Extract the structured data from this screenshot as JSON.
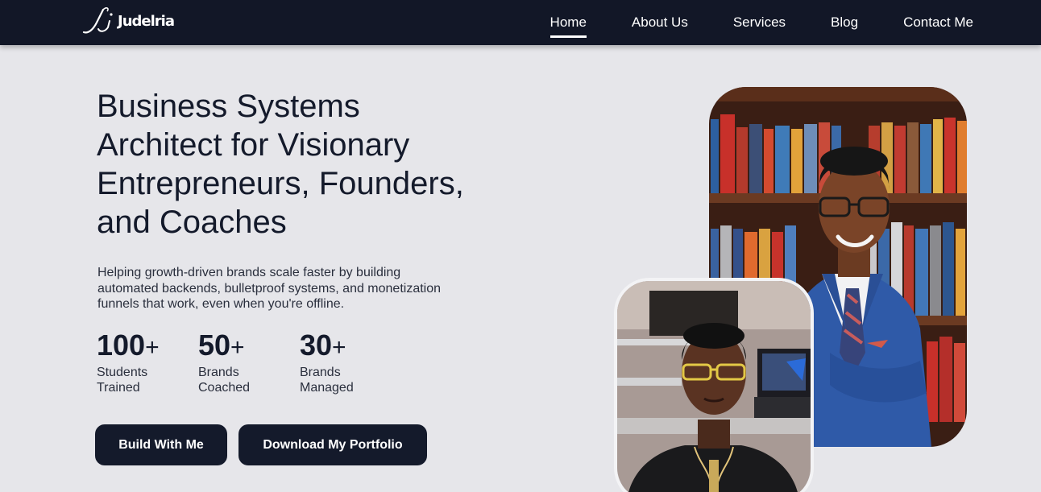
{
  "header": {
    "logo_text": "Judelria",
    "nav": [
      {
        "label": "Home",
        "active": true
      },
      {
        "label": "About Us",
        "active": false
      },
      {
        "label": "Services",
        "active": false
      },
      {
        "label": "Blog",
        "active": false
      },
      {
        "label": "Contact Me",
        "active": false
      }
    ]
  },
  "hero": {
    "title_lines": [
      "Business Systems",
      "Architect for Visionary",
      "Entrepreneurs, Founders,",
      "and Coaches"
    ],
    "subtitle_lines": [
      "Helping growth-driven brands scale faster by building",
      "automated backends, bulletproof systems, and monetization",
      "funnels that work, even when you're offline."
    ],
    "stats": [
      {
        "value": "100",
        "suffix": "+",
        "label_lines": [
          "Students",
          "Trained"
        ]
      },
      {
        "value": "50",
        "suffix": "+",
        "label_lines": [
          "Brands",
          "Coached"
        ]
      },
      {
        "value": "30",
        "suffix": "+",
        "label_lines": [
          "Brands",
          "Managed"
        ]
      }
    ],
    "buttons": {
      "primary": "Build With Me",
      "secondary": "Download My Portfolio"
    }
  },
  "colors": {
    "navbar_bg": "#121727",
    "page_bg": "#e6e6ea",
    "text_dark": "#141a2b",
    "button_bg": "#141a2b",
    "suit_blue": "#2f5aa8"
  },
  "images": {
    "large_photo": "portrait-man-in-blue-suit-bookshelf",
    "small_photo": "portrait-man-yellow-glasses-black-shirt"
  }
}
